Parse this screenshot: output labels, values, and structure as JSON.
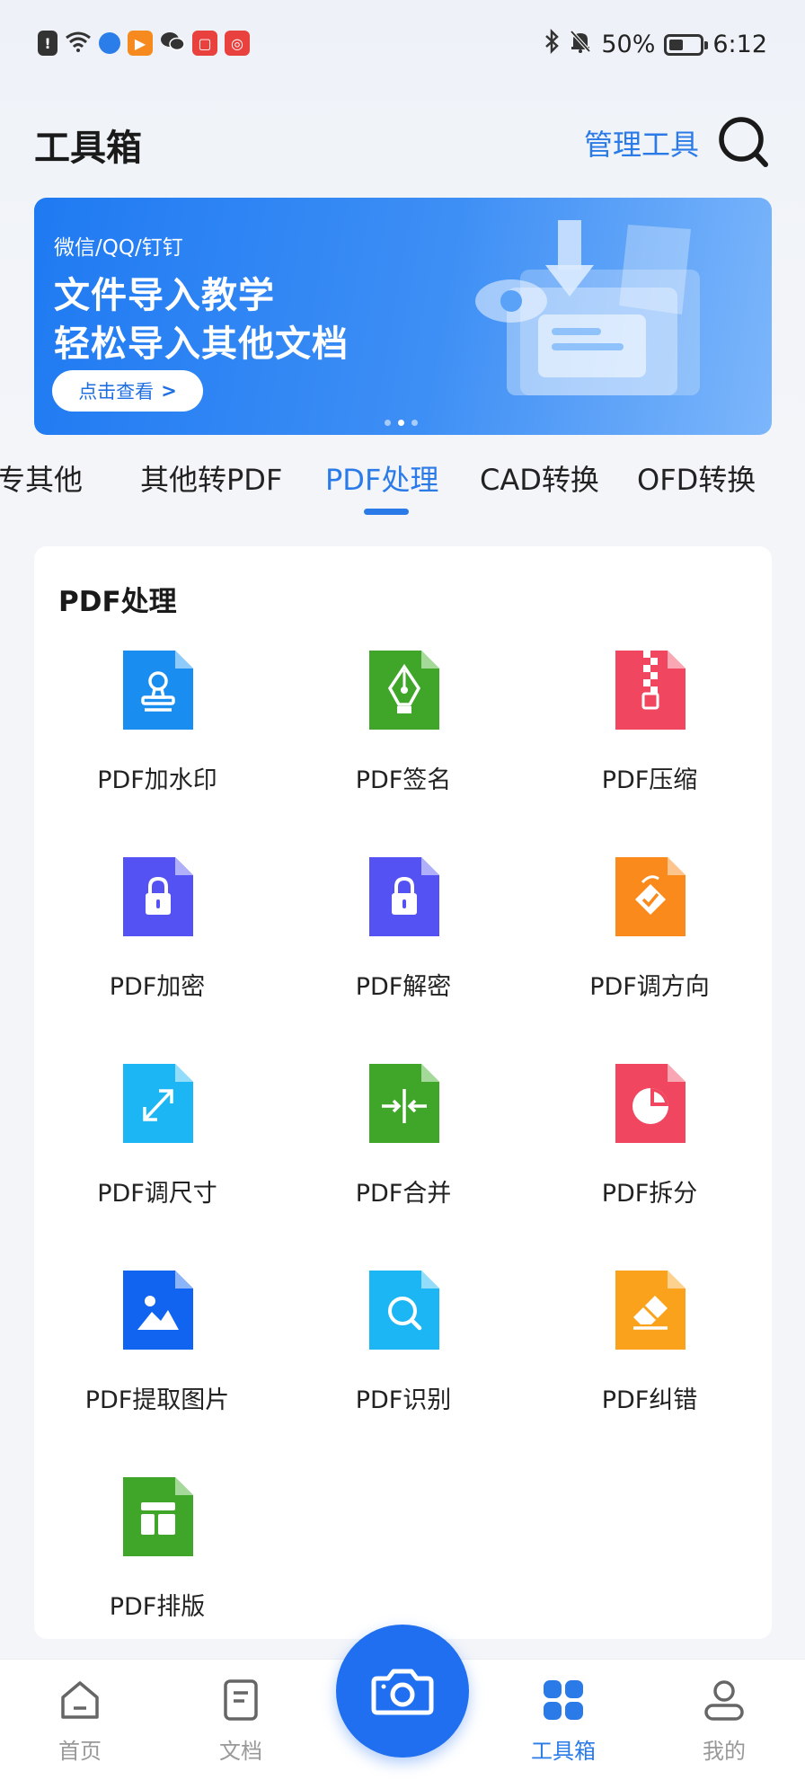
{
  "status_bar": {
    "battery": "50%",
    "time": "6:12",
    "left_icons": [
      "alert-icon",
      "wifi-icon",
      "browser-icon",
      "video-app-icon",
      "wechat-icon",
      "book-app-icon",
      "shopping-app-icon"
    ],
    "right_icons": [
      "bluetooth-icon",
      "mute-bell-icon",
      "battery-icon"
    ]
  },
  "header": {
    "title": "工具箱",
    "manage_label": "管理工具",
    "search_icon": "search-icon"
  },
  "banner": {
    "subtitle": "微信/QQ/钉钉",
    "title_line1": "文件导入教学",
    "title_line2": "轻松导入其他文档",
    "button_label": "点击查看",
    "button_arrow": ">",
    "active_dot": 1,
    "dot_count": 3
  },
  "tabs": [
    {
      "label": "转其他",
      "visible_text": "专其他"
    },
    {
      "label": "其他转PDF"
    },
    {
      "label": "PDF处理",
      "active": true
    },
    {
      "label": "CAD转换"
    },
    {
      "label": "OFD转换"
    }
  ],
  "section": {
    "title": "PDF处理",
    "tools": [
      {
        "label": "PDF加水印",
        "icon": "stamp-icon",
        "color": "#1a8ef0"
      },
      {
        "label": "PDF签名",
        "icon": "pen-nib-icon",
        "color": "#3fa629"
      },
      {
        "label": "PDF压缩",
        "icon": "zip-icon",
        "color": "#f0465f"
      },
      {
        "label": "PDF加密",
        "icon": "lock-icon",
        "color": "#5452f2"
      },
      {
        "label": "PDF解密",
        "icon": "lock-icon",
        "color": "#5452f2"
      },
      {
        "label": "PDF调方向",
        "icon": "rotate-icon",
        "color": "#fb8a1c"
      },
      {
        "label": "PDF调尺寸",
        "icon": "resize-icon",
        "color": "#1cb6f5"
      },
      {
        "label": "PDF合并",
        "icon": "merge-icon",
        "color": "#3fa629"
      },
      {
        "label": "PDF拆分",
        "icon": "pie-split-icon",
        "color": "#f0465f"
      },
      {
        "label": "PDF提取图片",
        "icon": "image-icon",
        "color": "#1064f0"
      },
      {
        "label": "PDF识别",
        "icon": "magnifier-icon",
        "color": "#1cb6f5"
      },
      {
        "label": "PDF纠错",
        "icon": "eraser-icon",
        "color": "#fba21c"
      },
      {
        "label": "PDF排版",
        "icon": "layout-icon",
        "color": "#3fa629"
      }
    ]
  },
  "bottom_nav": {
    "items": [
      {
        "label": "首页",
        "icon": "home-icon"
      },
      {
        "label": "文档",
        "icon": "document-icon"
      },
      {
        "label": "工具箱",
        "icon": "grid-icon",
        "active": true
      },
      {
        "label": "我的",
        "icon": "profile-icon"
      }
    ],
    "camera_icon": "camera-icon"
  },
  "colors": {
    "accent": "#2a7ae8",
    "camera": "#1f6ff0",
    "banner": "#1f7af2"
  }
}
